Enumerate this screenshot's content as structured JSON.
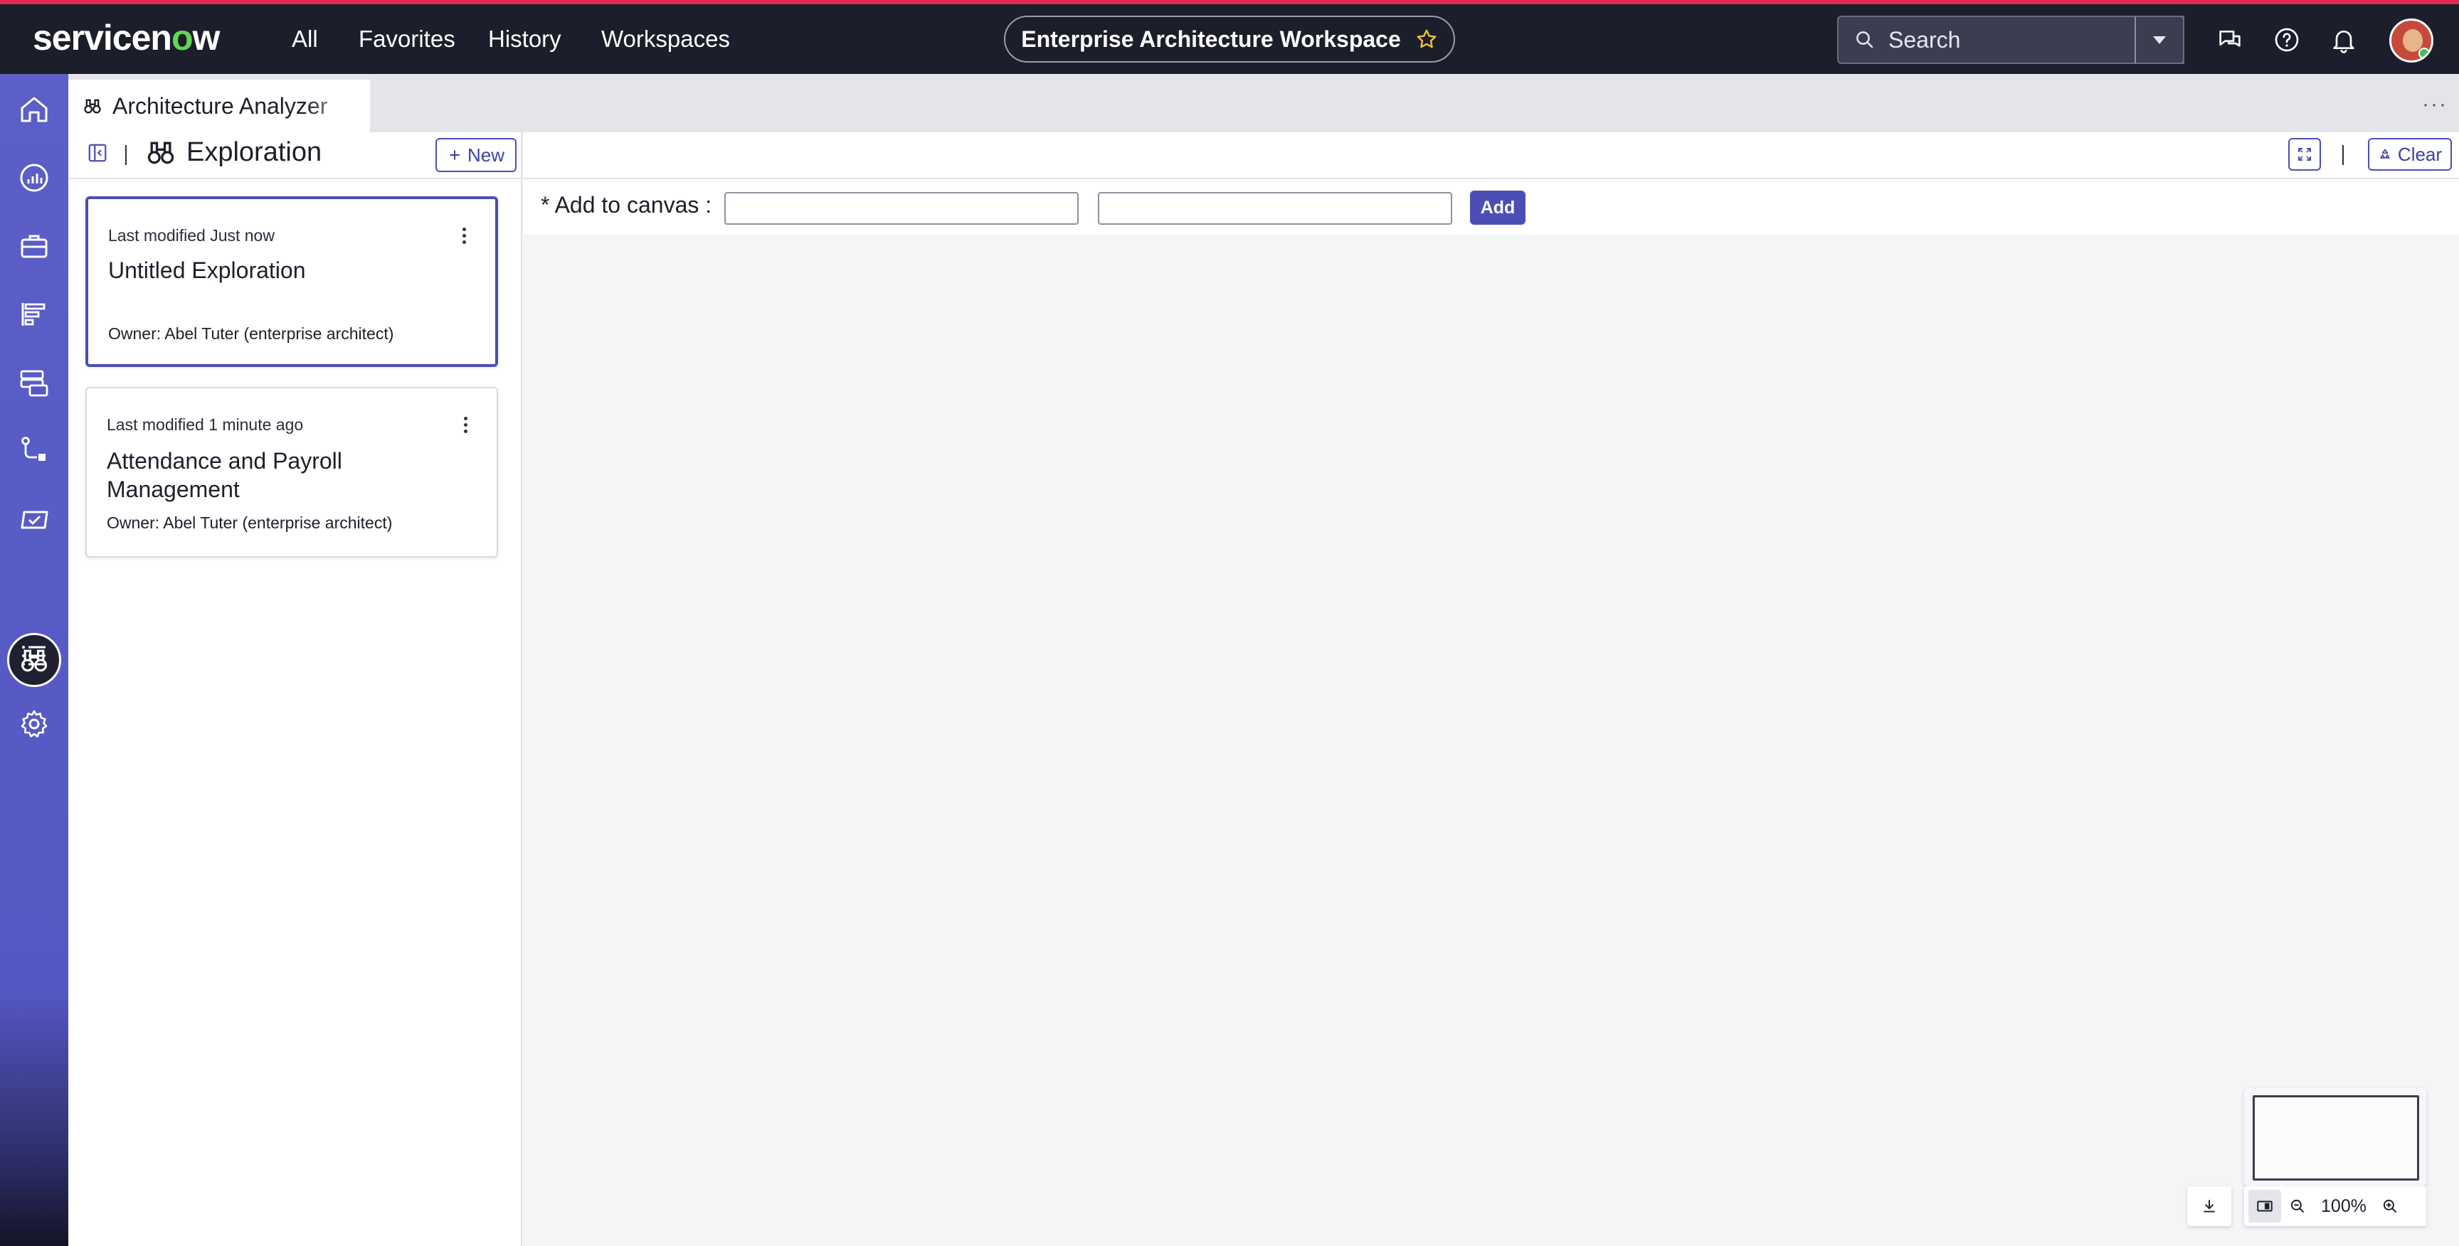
{
  "header": {
    "logo_text_a": "servicen",
    "logo_text_o": "o",
    "logo_text_b": "w",
    "nav": [
      "All",
      "Favorites",
      "History",
      "Workspaces"
    ],
    "workspace_title": "Enterprise Architecture Workspace",
    "search_placeholder": "Search",
    "icons": [
      "chat-icon",
      "help-icon",
      "bell-icon",
      "avatar"
    ]
  },
  "rail": {
    "items": [
      "home-icon",
      "analytics-icon",
      "briefcase-icon",
      "roadmap-icon",
      "data-icon",
      "flow-icon",
      "check-icon",
      "binoculars-icon",
      "list-icon",
      "settings-icon"
    ],
    "active": "binoculars-icon"
  },
  "tab": {
    "label": "Architecture Analyzer"
  },
  "panel": {
    "title": "Exploration",
    "new_label": "New",
    "cards": [
      {
        "meta": "Last modified Just now",
        "title": "Untitled Exploration",
        "owner": "Owner: Abel Tuter (enterprise architect)",
        "selected": true
      },
      {
        "meta": "Last modified 1 minute ago",
        "title": "Attendance and Payroll Management",
        "owner": "Owner: Abel Tuter (enterprise architect)",
        "selected": false
      }
    ]
  },
  "toolbar": {
    "clear_label": "Clear"
  },
  "canvas": {
    "add_label": "* Add to canvas :",
    "add_button": "Add",
    "input1_value": "",
    "input2_value": ""
  },
  "zoom": {
    "level": "100%"
  },
  "colors": {
    "accent": "#4b4fb5",
    "header_bg": "#1c1e2b",
    "rail_bg": "#5b5fc7",
    "header_stripe": "#e3274e"
  }
}
